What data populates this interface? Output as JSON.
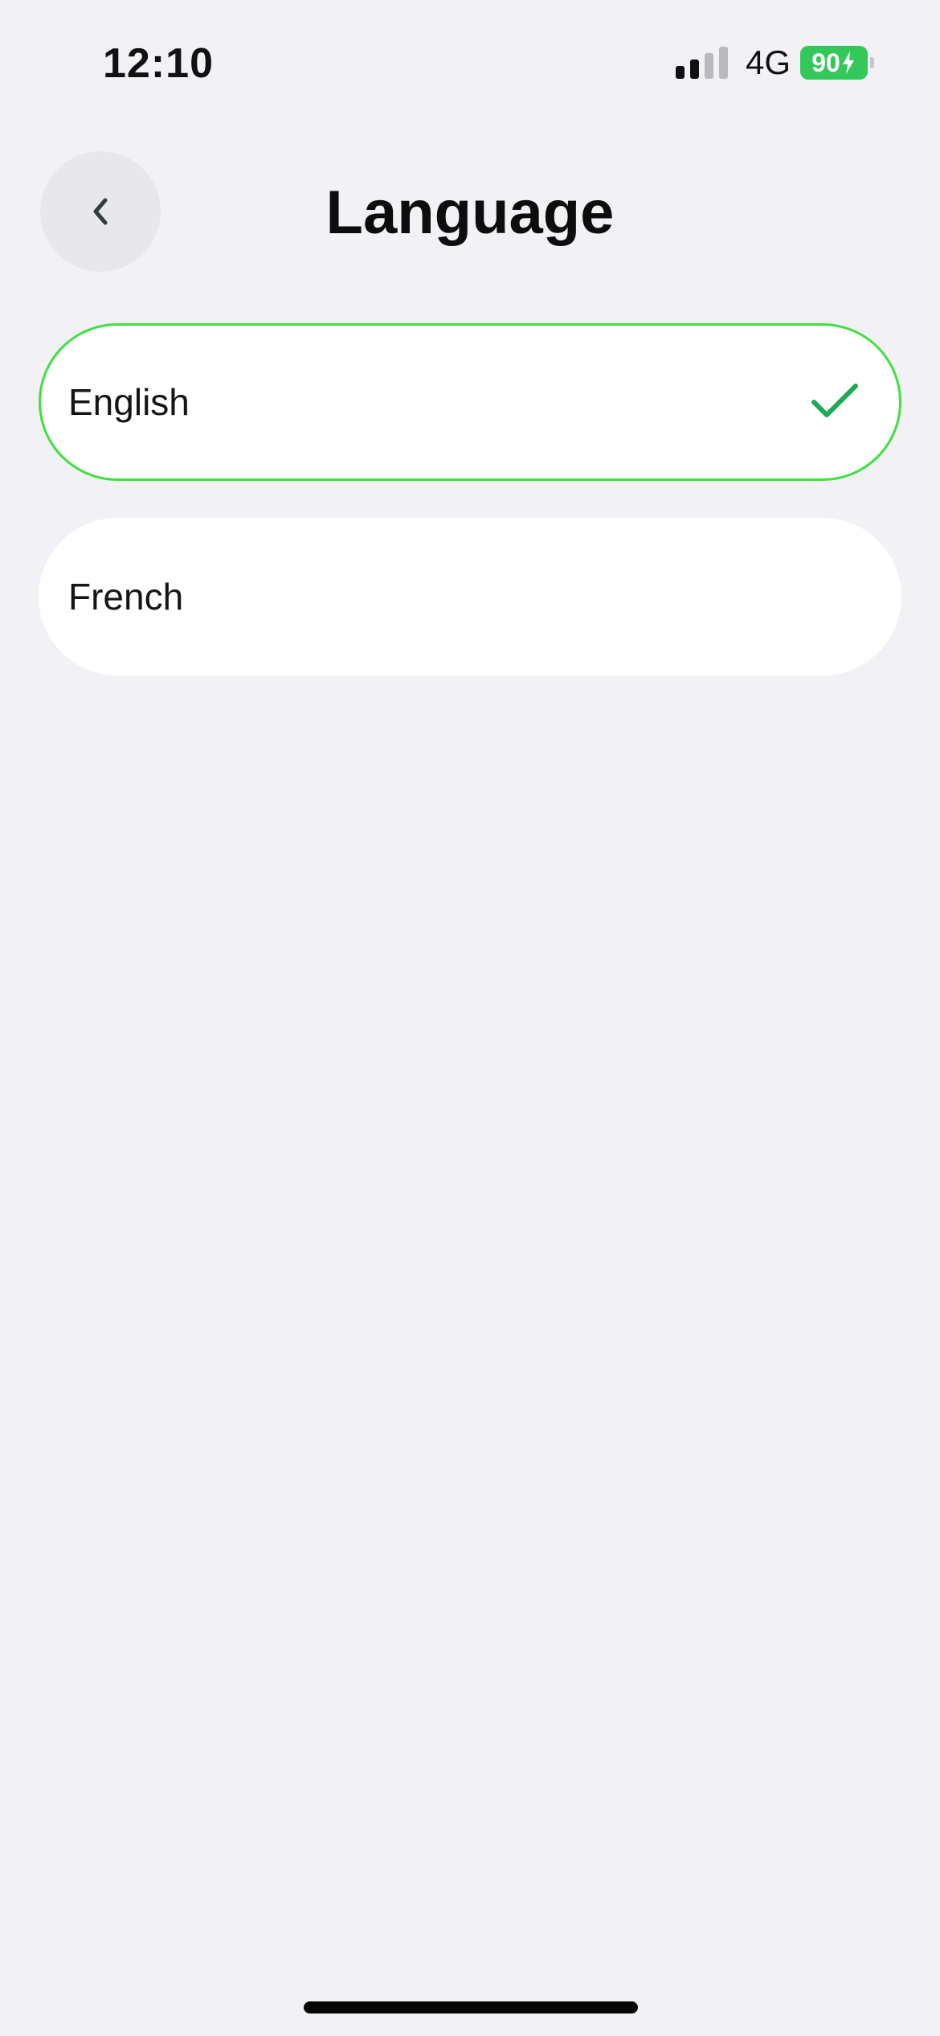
{
  "status_bar": {
    "time": "12:10",
    "network": "4G",
    "battery_percent": "90",
    "battery_color": "#34c759",
    "signal_bars_filled": 2,
    "signal_bars_total": 4,
    "charging": true
  },
  "header": {
    "title": "Language",
    "back_icon": "chevron-left-icon"
  },
  "languages": [
    {
      "label": "English",
      "selected": true
    },
    {
      "label": "French",
      "selected": false
    }
  ],
  "colors": {
    "selected_border": "#3fe03f",
    "check_mark": "#1faa55",
    "background": "#f1f1f6"
  }
}
